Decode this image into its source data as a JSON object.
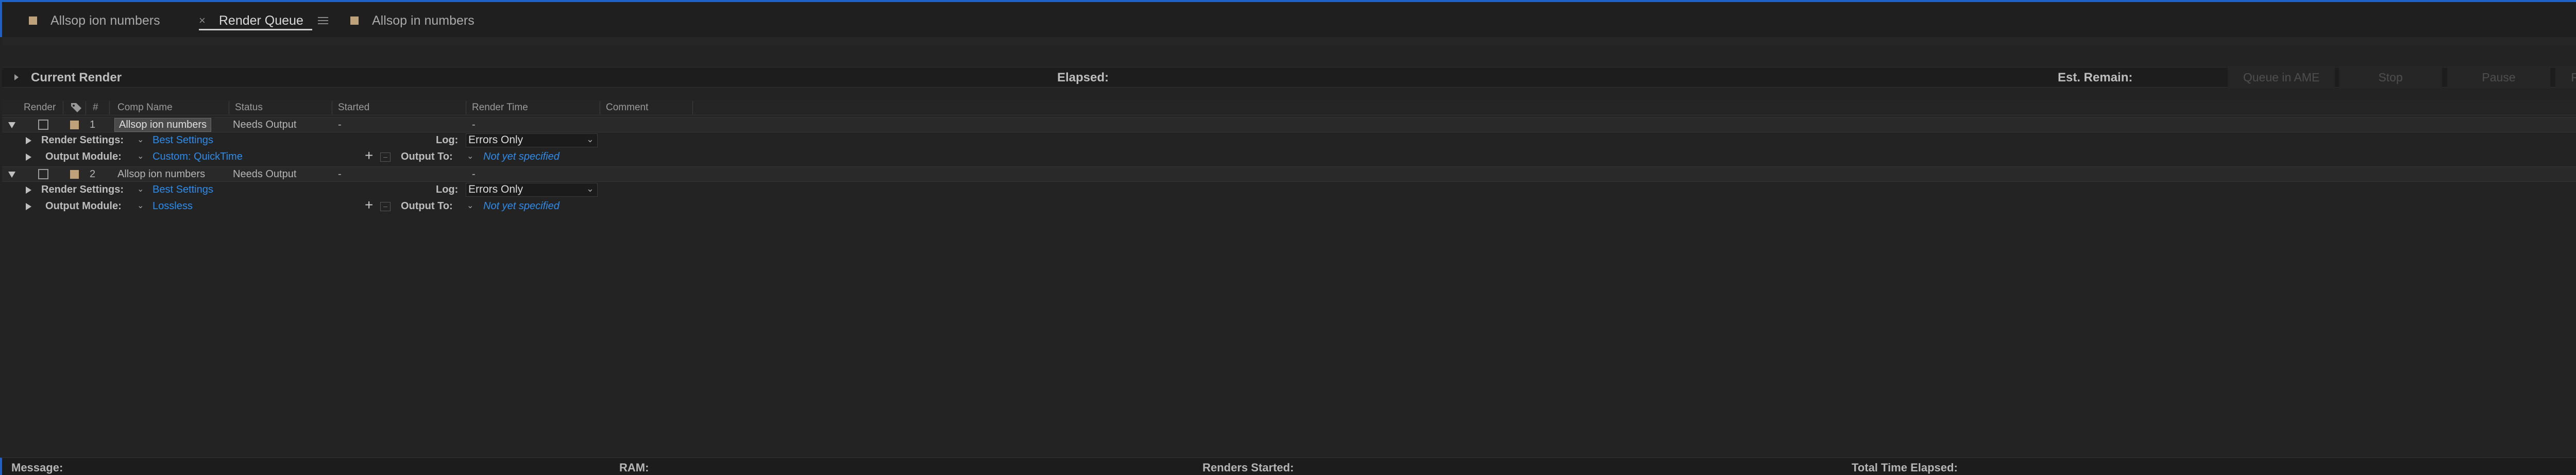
{
  "tabs": [
    {
      "label": "Allsop ion numbers"
    },
    {
      "label": "Render Queue",
      "active": true
    },
    {
      "label": "Allsop in numbers"
    }
  ],
  "current_render": {
    "label": "Current Render",
    "elapsed_label": "Elapsed:",
    "est_remain_label": "Est. Remain:"
  },
  "buttons": {
    "queue_in_ame": "Queue in AME",
    "stop": "Stop",
    "pause": "Pause",
    "render": "Render"
  },
  "columns": {
    "render": "Render",
    "number": "#",
    "comp_name": "Comp Name",
    "status": "Status",
    "started": "Started",
    "render_time": "Render Time",
    "comment": "Comment"
  },
  "items": [
    {
      "number": "1",
      "comp_name": "Allsop ion numbers",
      "status": "Needs Output",
      "started": "-",
      "render_time": "-",
      "render_settings_label": "Render Settings:",
      "render_settings_value": "Best Settings",
      "output_module_label": "Output Module:",
      "output_module_value": "Custom: QuickTime",
      "log_label": "Log:",
      "log_value": "Errors Only",
      "output_to_label": "Output To:",
      "output_to_value": "Not yet specified"
    },
    {
      "number": "2",
      "comp_name": "Allsop ion numbers",
      "status": "Needs Output",
      "started": "-",
      "render_time": "-",
      "render_settings_label": "Render Settings:",
      "render_settings_value": "Best Settings",
      "output_module_label": "Output Module:",
      "output_module_value": "Lossless",
      "log_label": "Log:",
      "log_value": "Errors Only",
      "output_to_label": "Output To:",
      "output_to_value": "Not yet specified"
    }
  ],
  "footer": {
    "message": "Message:",
    "ram": "RAM:",
    "renders_started": "Renders Started:",
    "total_time_elapsed": "Total Time Elapsed:"
  },
  "colors": {
    "accent_blue": "#1e62c8",
    "link_blue": "#2d8ceb",
    "label_tan": "#bfa27a"
  }
}
